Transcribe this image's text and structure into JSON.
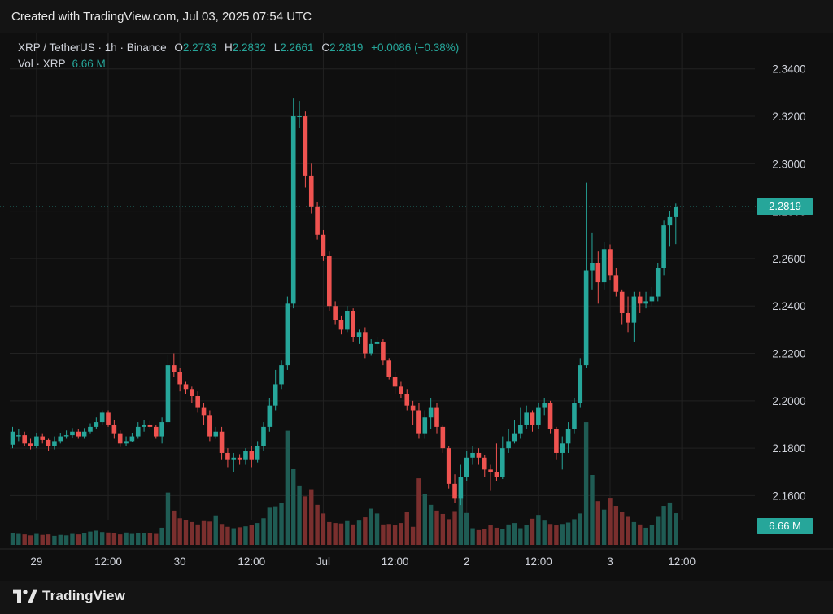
{
  "header": {
    "created": "Created with TradingView.com, Jul 03, 2025 07:54 UTC"
  },
  "legend": {
    "symbol": "XRP / TetherUS · 1h · Binance",
    "o_label": "O",
    "o_value": "2.2733",
    "h_label": "H",
    "h_value": "2.2832",
    "l_label": "L",
    "l_value": "2.2661",
    "c_label": "C",
    "c_value": "2.2819",
    "change": "+0.0086 (+0.38%)",
    "vol_label": "Vol · XRP",
    "vol_value": "6.66 M"
  },
  "footer": {
    "brand": "TradingView"
  },
  "colors": {
    "up": "#26a69a",
    "down": "#ef5350",
    "background": "#0f0f0f",
    "grid": "#222222"
  },
  "chart_data": {
    "type": "candlestick",
    "ylim": [
      2.1478,
      2.3478
    ],
    "y_ticks": [
      "2.3400",
      "2.3200",
      "2.3000",
      "2.2800",
      "2.2600",
      "2.2400",
      "2.2200",
      "2.2000",
      "2.1800",
      "2.1600"
    ],
    "x_ticks": [
      {
        "label": "29",
        "index": 4
      },
      {
        "label": "12:00",
        "index": 16
      },
      {
        "label": "30",
        "index": 28
      },
      {
        "label": "12:00",
        "index": 40
      },
      {
        "label": "Jul",
        "index": 52
      },
      {
        "label": "12:00",
        "index": 64
      },
      {
        "label": "2",
        "index": 76
      },
      {
        "label": "12:00",
        "index": 88
      },
      {
        "label": "3",
        "index": 100
      },
      {
        "label": "12:00",
        "index": 112
      }
    ],
    "last_price": "2.2819",
    "last_volume": "6.66 M",
    "open": [
      2.1815,
      2.185,
      2.1855,
      2.182,
      2.181,
      2.185,
      2.1835,
      2.181,
      2.183,
      2.185,
      2.1855,
      2.187,
      2.185,
      2.187,
      2.189,
      2.191,
      2.195,
      2.19,
      2.186,
      2.182,
      2.183,
      2.185,
      2.189,
      2.19,
      2.189,
      2.185,
      2.191,
      2.215,
      2.212,
      2.207,
      2.205,
      2.202,
      2.197,
      2.194,
      2.185,
      2.187,
      2.178,
      2.175,
      2.176,
      2.175,
      2.179,
      2.175,
      2.181,
      2.189,
      2.198,
      2.207,
      2.215,
      2.241,
      2.32,
      2.32,
      2.295,
      2.282,
      2.27,
      2.261,
      2.24,
      2.234,
      2.23,
      2.238,
      2.227,
      2.229,
      2.22,
      2.224,
      2.225,
      2.217,
      2.21,
      2.206,
      2.203,
      2.198,
      2.196,
      2.186,
      2.193,
      2.197,
      2.189,
      2.18,
      2.165,
      2.159,
      2.168,
      2.176,
      2.178,
      2.176,
      2.171,
      2.17,
      2.168,
      2.18,
      2.183,
      2.186,
      2.19,
      2.195,
      2.19,
      2.197,
      2.199,
      2.188,
      2.178,
      2.182,
      2.188,
      2.199,
      2.215,
      2.255,
      2.258,
      2.25,
      2.264,
      2.253,
      2.246,
      2.237,
      2.233,
      2.244,
      2.241,
      2.242,
      2.244,
      2.256,
      2.274,
      2.2775
    ],
    "close": [
      2.187,
      2.1855,
      2.182,
      2.181,
      2.185,
      2.1835,
      2.181,
      2.183,
      2.185,
      2.1855,
      2.187,
      2.185,
      2.187,
      2.189,
      2.191,
      2.195,
      2.19,
      2.186,
      2.182,
      2.183,
      2.185,
      2.189,
      2.19,
      2.189,
      2.185,
      2.191,
      2.215,
      2.212,
      2.207,
      2.205,
      2.202,
      2.197,
      2.194,
      2.185,
      2.187,
      2.178,
      2.175,
      2.176,
      2.175,
      2.179,
      2.175,
      2.181,
      2.189,
      2.198,
      2.207,
      2.215,
      2.241,
      2.32,
      2.32,
      2.295,
      2.282,
      2.27,
      2.261,
      2.24,
      2.234,
      2.23,
      2.238,
      2.227,
      2.229,
      2.22,
      2.224,
      2.225,
      2.217,
      2.21,
      2.206,
      2.203,
      2.198,
      2.196,
      2.186,
      2.193,
      2.197,
      2.189,
      2.18,
      2.165,
      2.159,
      2.168,
      2.176,
      2.178,
      2.176,
      2.171,
      2.17,
      2.168,
      2.18,
      2.183,
      2.186,
      2.19,
      2.195,
      2.19,
      2.197,
      2.199,
      2.188,
      2.178,
      2.182,
      2.188,
      2.199,
      2.215,
      2.255,
      2.258,
      2.25,
      2.264,
      2.253,
      2.246,
      2.237,
      2.233,
      2.244,
      2.241,
      2.242,
      2.244,
      2.256,
      2.274,
      2.2775,
      2.2819
    ],
    "high": [
      2.189,
      2.188,
      2.187,
      2.184,
      2.1865,
      2.186,
      2.184,
      2.185,
      2.1865,
      2.1875,
      2.1885,
      2.188,
      2.1885,
      2.1905,
      2.193,
      2.196,
      2.196,
      2.192,
      2.1875,
      2.185,
      2.1865,
      2.191,
      2.192,
      2.1915,
      2.19,
      2.193,
      2.2195,
      2.22,
      2.214,
      2.208,
      2.206,
      2.204,
      2.199,
      2.196,
      2.189,
      2.189,
      2.18,
      2.178,
      2.1775,
      2.18,
      2.181,
      2.183,
      2.191,
      2.201,
      2.213,
      2.217,
      2.244,
      2.3275,
      2.3265,
      2.322,
      2.3,
      2.284,
      2.272,
      2.263,
      2.242,
      2.236,
      2.24,
      2.239,
      2.23,
      2.231,
      2.226,
      2.227,
      2.226,
      2.218,
      2.212,
      2.208,
      2.205,
      2.2,
      2.199,
      2.196,
      2.201,
      2.199,
      2.19,
      2.181,
      2.169,
      2.173,
      2.179,
      2.181,
      2.18,
      2.177,
      2.173,
      2.182,
      2.185,
      2.188,
      2.192,
      2.197,
      2.198,
      2.196,
      2.199,
      2.201,
      2.2,
      2.189,
      2.185,
      2.191,
      2.201,
      2.218,
      2.292,
      2.271,
      2.263,
      2.267,
      2.266,
      2.256,
      2.247,
      2.244,
      2.246,
      2.246,
      2.246,
      2.248,
      2.258,
      2.276,
      2.28,
      2.2832
    ],
    "low": [
      2.18,
      2.183,
      2.181,
      2.1795,
      2.18,
      2.182,
      2.179,
      2.1795,
      2.182,
      2.184,
      2.1845,
      2.184,
      2.184,
      2.186,
      2.188,
      2.19,
      2.189,
      2.184,
      2.1805,
      2.181,
      2.1825,
      2.184,
      2.187,
      2.188,
      2.184,
      2.182,
      2.19,
      2.21,
      2.204,
      2.203,
      2.199,
      2.195,
      2.19,
      2.183,
      2.184,
      2.175,
      2.172,
      2.17,
      2.173,
      2.173,
      2.172,
      2.174,
      2.179,
      2.187,
      2.196,
      2.205,
      2.213,
      2.239,
      2.315,
      2.29,
      2.279,
      2.268,
      2.259,
      2.238,
      2.232,
      2.228,
      2.229,
      2.225,
      2.224,
      2.218,
      2.219,
      2.222,
      2.215,
      2.209,
      2.203,
      2.201,
      2.196,
      2.19,
      2.184,
      2.184,
      2.188,
      2.186,
      2.178,
      2.163,
      2.157,
      2.156,
      2.166,
      2.173,
      2.173,
      2.168,
      2.162,
      2.166,
      2.167,
      2.178,
      2.182,
      2.184,
      2.188,
      2.187,
      2.188,
      2.194,
      2.186,
      2.175,
      2.171,
      2.178,
      2.186,
      2.197,
      2.214,
      2.247,
      2.241,
      2.247,
      2.251,
      2.244,
      2.232,
      2.229,
      2.225,
      2.237,
      2.239,
      2.24,
      2.242,
      2.253,
      2.265,
      2.2661
    ],
    "volume": [
      2.5,
      2.3,
      2.2,
      2.0,
      2.3,
      2.1,
      2.2,
      1.9,
      2.1,
      2.0,
      2.3,
      2.2,
      2.4,
      2.8,
      3.0,
      2.7,
      2.6,
      2.4,
      2.2,
      2.6,
      2.3,
      2.4,
      2.5,
      2.5,
      2.3,
      3.6,
      11.0,
      7.2,
      5.6,
      5.2,
      4.8,
      4.3,
      5.0,
      4.9,
      6.2,
      4.4,
      3.8,
      3.5,
      3.7,
      3.9,
      4.2,
      4.6,
      5.6,
      7.8,
      8.1,
      8.8,
      24.0,
      15.9,
      12.5,
      10.2,
      11.7,
      8.4,
      6.6,
      4.8,
      4.6,
      4.5,
      5.0,
      4.3,
      5.1,
      5.8,
      7.6,
      6.6,
      4.3,
      4.4,
      4.1,
      4.6,
      7.0,
      3.8,
      14.0,
      10.6,
      8.4,
      7.2,
      6.5,
      5.4,
      7.1,
      10.9,
      6.7,
      3.5,
      3.1,
      3.4,
      4.1,
      3.6,
      3.4,
      4.3,
      4.6,
      3.5,
      4.2,
      5.5,
      6.3,
      5.1,
      4.4,
      4.1,
      4.4,
      4.7,
      5.4,
      6.6,
      25.8,
      14.7,
      9.2,
      7.4,
      9.9,
      8.2,
      6.9,
      5.9,
      4.8,
      4.3,
      3.6,
      4.2,
      5.9,
      8.2,
      8.9,
      6.66
    ]
  }
}
